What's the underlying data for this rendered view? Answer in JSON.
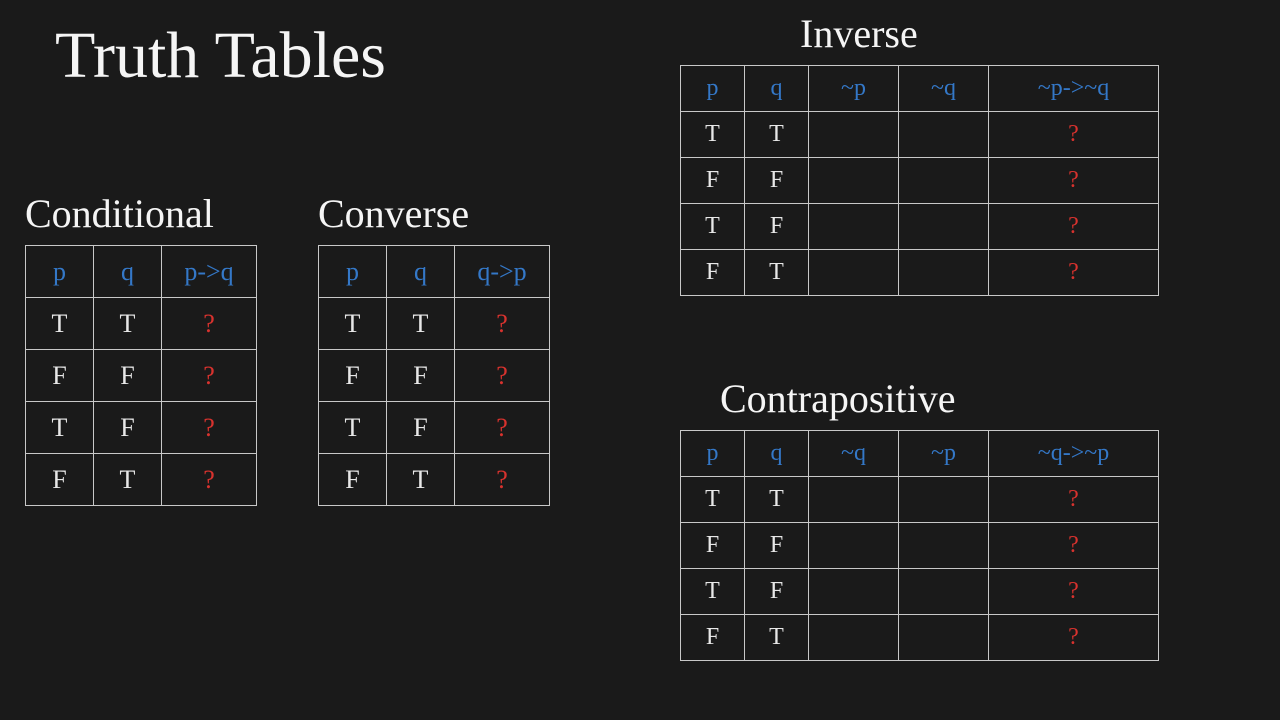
{
  "title": "Truth Tables",
  "sections": {
    "conditional": {
      "label": "Conditional",
      "headers": [
        "p",
        "q",
        "p->q"
      ],
      "rows": [
        [
          "T",
          "T",
          "?"
        ],
        [
          "F",
          "F",
          "?"
        ],
        [
          "T",
          "F",
          "?"
        ],
        [
          "F",
          "T",
          "?"
        ]
      ]
    },
    "converse": {
      "label": "Converse",
      "headers": [
        "p",
        "q",
        "q->p"
      ],
      "rows": [
        [
          "T",
          "T",
          "?"
        ],
        [
          "F",
          "F",
          "?"
        ],
        [
          "T",
          "F",
          "?"
        ],
        [
          "F",
          "T",
          "?"
        ]
      ]
    },
    "inverse": {
      "label": "Inverse",
      "headers": [
        "p",
        "q",
        "~p",
        "~q",
        "~p->~q"
      ],
      "rows": [
        [
          "T",
          "T",
          "",
          "",
          "?"
        ],
        [
          "F",
          "F",
          "",
          "",
          "?"
        ],
        [
          "T",
          "F",
          "",
          "",
          "?"
        ],
        [
          "F",
          "T",
          "",
          "",
          "?"
        ]
      ]
    },
    "contrapositive": {
      "label": "Contrapositive",
      "headers": [
        "p",
        "q",
        "~q",
        "~p",
        "~q->~p"
      ],
      "rows": [
        [
          "T",
          "T",
          "",
          "",
          "?"
        ],
        [
          "F",
          "F",
          "",
          "",
          "?"
        ],
        [
          "T",
          "F",
          "",
          "",
          "?"
        ],
        [
          "F",
          "T",
          "",
          "",
          "?"
        ]
      ]
    }
  },
  "chart_data": [
    {
      "type": "table",
      "title": "Conditional",
      "columns": [
        "p",
        "q",
        "p->q"
      ],
      "rows": [
        [
          "T",
          "T",
          "?"
        ],
        [
          "F",
          "F",
          "?"
        ],
        [
          "T",
          "F",
          "?"
        ],
        [
          "F",
          "T",
          "?"
        ]
      ]
    },
    {
      "type": "table",
      "title": "Converse",
      "columns": [
        "p",
        "q",
        "q->p"
      ],
      "rows": [
        [
          "T",
          "T",
          "?"
        ],
        [
          "F",
          "F",
          "?"
        ],
        [
          "T",
          "F",
          "?"
        ],
        [
          "F",
          "T",
          "?"
        ]
      ]
    },
    {
      "type": "table",
      "title": "Inverse",
      "columns": [
        "p",
        "q",
        "~p",
        "~q",
        "~p->~q"
      ],
      "rows": [
        [
          "T",
          "T",
          "",
          "",
          "?"
        ],
        [
          "F",
          "F",
          "",
          "",
          "?"
        ],
        [
          "T",
          "F",
          "",
          "",
          "?"
        ],
        [
          "F",
          "T",
          "",
          "",
          "?"
        ]
      ]
    },
    {
      "type": "table",
      "title": "Contrapositive",
      "columns": [
        "p",
        "q",
        "~q",
        "~p",
        "~q->~p"
      ],
      "rows": [
        [
          "T",
          "T",
          "",
          "",
          "?"
        ],
        [
          "F",
          "F",
          "",
          "",
          "?"
        ],
        [
          "T",
          "F",
          "",
          "",
          "?"
        ],
        [
          "F",
          "T",
          "",
          "",
          "?"
        ]
      ]
    }
  ]
}
